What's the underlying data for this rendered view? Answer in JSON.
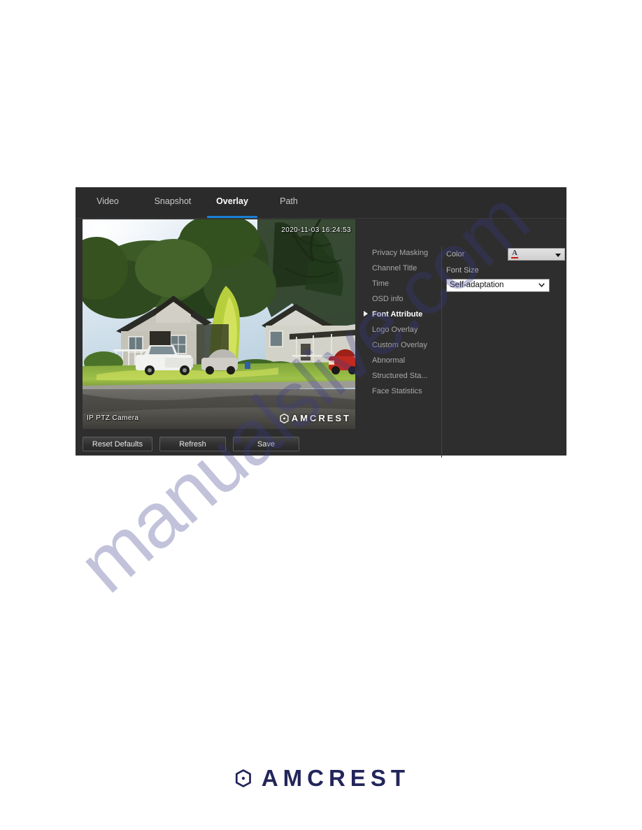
{
  "page": {
    "background_color": "#ffffff",
    "watermark_text": "manualslive.com",
    "watermark_color": "#3a3a8c"
  },
  "panel": {
    "background_color": "#2e2e2e",
    "accent_color": "#1a7fd4"
  },
  "tabs": [
    {
      "id": "video",
      "label": "Video",
      "active": false
    },
    {
      "id": "snapshot",
      "label": "Snapshot",
      "active": false
    },
    {
      "id": "overlay",
      "label": "Overlay",
      "active": true
    },
    {
      "id": "path",
      "label": "Path",
      "active": false
    }
  ],
  "video_preview": {
    "osd_time": "2020-11-03 16:24:53",
    "osd_channel_title": "IP PTZ Camera",
    "osd_logo_text": "AMCREST",
    "osd_logo_icon": "amcrest-hexagon-icon",
    "scene_description": "Daytime residential street view with two houses, trees, a white pickup truck, a silver sedan and a red vehicle"
  },
  "overlay_menu": {
    "items": [
      {
        "label": "Privacy Masking",
        "selected": false
      },
      {
        "label": "Channel Title",
        "selected": false
      },
      {
        "label": "Time",
        "selected": false
      },
      {
        "label": "OSD info",
        "selected": false
      },
      {
        "label": "Font Attribute",
        "selected": true
      },
      {
        "label": "Logo Overlay",
        "selected": false
      },
      {
        "label": "Custom Overlay",
        "selected": false
      },
      {
        "label": "Abnormal",
        "selected": false
      },
      {
        "label": "Structured Sta...",
        "selected": false
      },
      {
        "label": "Face Statistics",
        "selected": false
      }
    ]
  },
  "properties": {
    "color": {
      "label": "Color",
      "glyph": "A",
      "swatch_color": "#cc1111",
      "icon": "chevron-down-icon"
    },
    "font_size": {
      "label": "Font Size",
      "value": "Self-adaptation",
      "options": [
        "Self-adaptation"
      ]
    }
  },
  "actions": {
    "reset_label": "Reset Defaults",
    "refresh_label": "Refresh",
    "save_label": "Save"
  },
  "footer": {
    "brand": "AMCREST",
    "logo_icon": "amcrest-hexagon-icon",
    "brand_color": "#23265a"
  }
}
